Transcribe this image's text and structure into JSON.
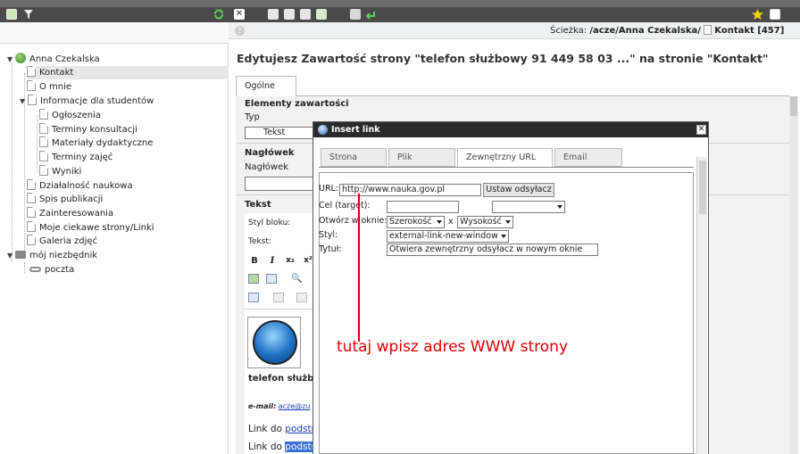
{
  "breadcrumb": {
    "label": "Ścieżka:",
    "path": "/acze/Anna Czekalska/",
    "page": "Kontakt [457]"
  },
  "tree": {
    "root": "Anna Czekalska",
    "items": [
      "Kontakt",
      "O mnie",
      "Informacje dla studentów",
      "Ogłoszenia",
      "Terminy konsultacji",
      "Materiały dydaktyczne",
      "Terminy zajęć",
      "Wyniki",
      "Działalność naukowa",
      "Spis publikacji",
      "Zainteresowania",
      "Moje ciekawe strony/Linki",
      "Galeria zdjęć"
    ],
    "folder": "mój niezbędnik",
    "folder_child": "poczta"
  },
  "editor": {
    "heading": "Edytujesz Zawartość strony \"telefon służbowy 91 449 58 03 ...\" na stronie \"Kontakt\"",
    "tab": "Ogólne",
    "elements_title": "Elementy zawartości",
    "typ_label": "Typ",
    "typ_value": "Tekst",
    "naglowek_title": "Nagłówek",
    "naglowek_label": "Nagłówek",
    "tekst_title": "Tekst",
    "styl_bloku": "Styl bloku:",
    "tekst_label": "Tekst:",
    "rte_bold": "B",
    "rte_italic": "I",
    "rte_sub": "x₂",
    "rte_sup": "x²",
    "content_phone": "telefon służbo",
    "content_email_label": "e-mail:",
    "content_email_value": "acze@zu",
    "link1_prefix": "Link do",
    "link1_text": "podstr",
    "link2_prefix": "Link do",
    "link2_text": "podstr"
  },
  "dialog": {
    "title": "Insert link",
    "tabs": [
      "Strona",
      "Plik",
      "Zewnętrzny URL",
      "Email"
    ],
    "active_tab": "Zewnętrzny URL",
    "url_label": "URL:",
    "url_value": "http://www.nauka.gov.pl",
    "set_button": "Ustaw odsyłacz",
    "target_label": "Cel (target):",
    "target_value": "",
    "target_select": "",
    "window_label": "Otwórz w oknie:",
    "width_select": "Szerokość",
    "times": "x",
    "height_select": "Wysokość",
    "style_label": "Styl:",
    "style_select": "external-link-new-window",
    "title_label": "Tytuł:",
    "title_value": "Otwiera zewnętrzny odsyłacz w nowym oknie"
  },
  "annotation": "tutaj wpisz adres WWW strony",
  "colors": {
    "toolbar": "#4a4a4a",
    "annotation": "#e00000",
    "link": "#1a3fb0",
    "selection": "#3a6fd8"
  }
}
